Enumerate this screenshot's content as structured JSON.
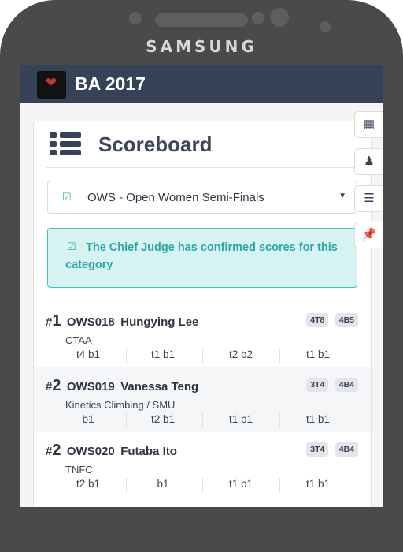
{
  "device": {
    "brand": "SAMSUNG"
  },
  "app": {
    "title": "BA 2017"
  },
  "scoreboard": {
    "title": "Scoreboard",
    "category_select": "OWS - Open Women Semi-Finals",
    "alert": "The Chief Judge has confirmed scores for this category"
  },
  "side_tabs": [
    {
      "icon": "calendar-icon"
    },
    {
      "icon": "climber-icon"
    },
    {
      "icon": "list-icon"
    },
    {
      "icon": "pin-icon"
    }
  ],
  "results": [
    {
      "rank_hash": "#",
      "rank": "1",
      "code": "OWS018",
      "name": "Hungying Lee",
      "club": "CTAA",
      "tops": [
        "4T8",
        "4B5"
      ],
      "attempts": [
        "t4 b1",
        "t1 b1",
        "t2 b2",
        "t1 b1"
      ]
    },
    {
      "rank_hash": "#",
      "rank": "2",
      "code": "OWS019",
      "name": "Vanessa Teng",
      "club": "Kinetics Climbing / SMU",
      "tops": [
        "3T4",
        "4B4"
      ],
      "attempts": [
        "b1",
        "t2 b1",
        "t1 b1",
        "t1 b1"
      ]
    },
    {
      "rank_hash": "#",
      "rank": "2",
      "code": "OWS020",
      "name": "Futaba Ito",
      "club": "TNFC",
      "tops": [
        "3T4",
        "4B4"
      ],
      "attempts": [
        "t2 b1",
        "b1",
        "t1 b1",
        "t1 b1"
      ]
    }
  ],
  "colors": {
    "header": "#354257",
    "accent": "#2fb5b1",
    "alert_bg": "#d6f3f1"
  }
}
